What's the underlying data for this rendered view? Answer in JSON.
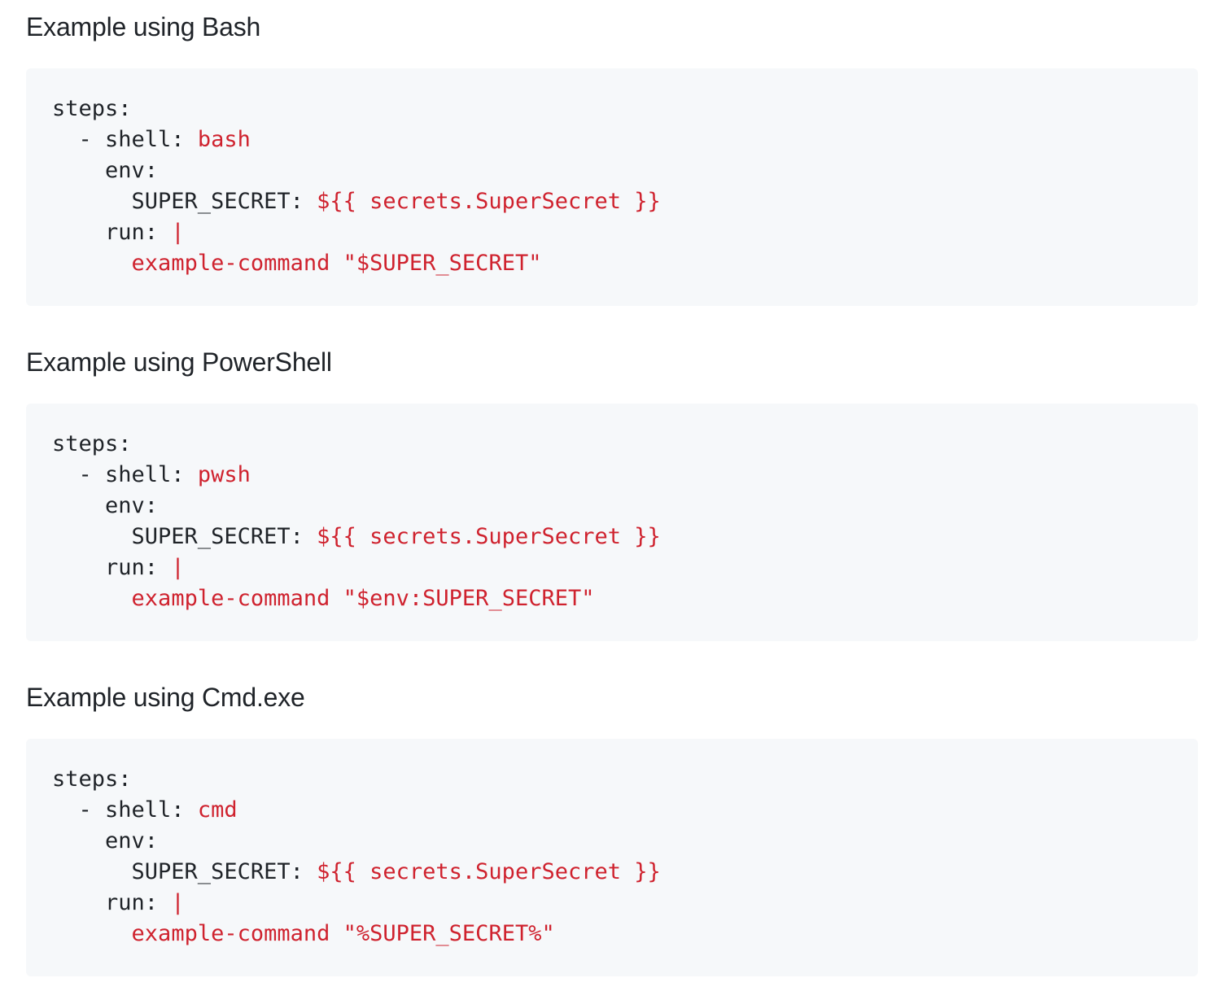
{
  "sections": [
    {
      "heading": "Example using Bash",
      "code": {
        "l1_key": "steps:",
        "l2_key": "  - shell: ",
        "l2_val": "bash",
        "l3_key": "    env:",
        "l4_key": "      SUPER_SECRET: ",
        "l4_val": "${{ secrets.SuperSecret }}",
        "l5_key": "    run: ",
        "l5_val": "|",
        "l6_indent": "      ",
        "l6_val": "example-command \"$SUPER_SECRET\""
      }
    },
    {
      "heading": "Example using PowerShell",
      "code": {
        "l1_key": "steps:",
        "l2_key": "  - shell: ",
        "l2_val": "pwsh",
        "l3_key": "    env:",
        "l4_key": "      SUPER_SECRET: ",
        "l4_val": "${{ secrets.SuperSecret }}",
        "l5_key": "    run: ",
        "l5_val": "|",
        "l6_indent": "      ",
        "l6_val": "example-command \"$env:SUPER_SECRET\""
      }
    },
    {
      "heading": "Example using Cmd.exe",
      "code": {
        "l1_key": "steps:",
        "l2_key": "  - shell: ",
        "l2_val": "cmd",
        "l3_key": "    env:",
        "l4_key": "      SUPER_SECRET: ",
        "l4_val": "${{ secrets.SuperSecret }}",
        "l5_key": "    run: ",
        "l5_val": "|",
        "l6_indent": "      ",
        "l6_val": "example-command \"%SUPER_SECRET%\""
      }
    }
  ]
}
